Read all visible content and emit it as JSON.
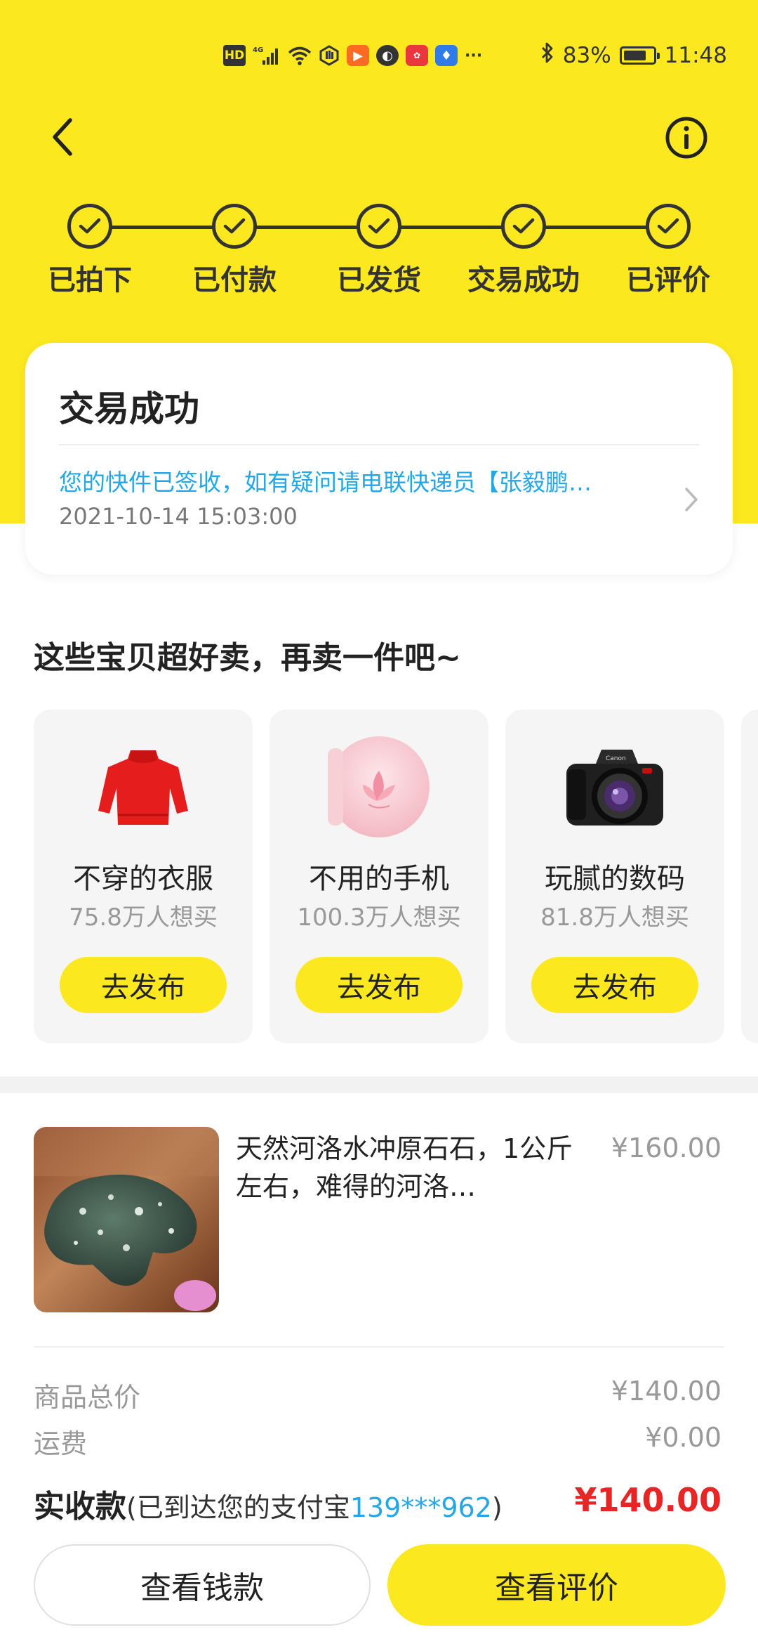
{
  "status_bar": {
    "time": "11:48",
    "battery": "83%",
    "battery_level": 0.83,
    "network": "4G",
    "hd_badge": "HD",
    "icons": [
      "hd-icon",
      "signal-icon",
      "wifi-icon",
      "hand-icon",
      "video-app-icon",
      "ball-app-icon",
      "huawei-app-icon",
      "bulb-app-icon",
      "more-icon",
      "bluetooth-icon",
      "battery-icon"
    ],
    "more": "···"
  },
  "nav": {
    "back_icon": "chevron-left-icon",
    "info_icon": "info-icon"
  },
  "steps": [
    {
      "label": "已拍下",
      "done": true
    },
    {
      "label": "已付款",
      "done": true
    },
    {
      "label": "已发货",
      "done": true
    },
    {
      "label": "交易成功",
      "done": true
    },
    {
      "label": "已评价",
      "done": true
    }
  ],
  "status_card": {
    "title": "交易成功",
    "message": "您的快件已签收，如有疑问请电联快递员【张毅鹏…",
    "time": "2021-10-14 15:03:00"
  },
  "recommend": {
    "title": "这些宝贝超好卖，再卖一件吧~",
    "cards": [
      {
        "name": "不穿的衣服",
        "count": "75.8万人想买",
        "button": "去发布",
        "icon": "sweater-icon"
      },
      {
        "name": "不用的手机",
        "count": "100.3万人想买",
        "button": "去发布",
        "icon": "phone-icon"
      },
      {
        "name": "玩腻的数码",
        "count": "81.8万人想买",
        "button": "去发布",
        "icon": "camera-icon"
      }
    ]
  },
  "order": {
    "title": "天然河洛水冲原石石，1公斤左右，难得的河洛…",
    "price": "¥160.00",
    "total_label": "商品总价",
    "total_value": "¥140.00",
    "shipping_label": "运费",
    "shipping_value": "¥0.00",
    "received_label": "实收款",
    "received_note_prefix": "(已到达您的支付宝",
    "received_account": "139***962",
    "received_note_suffix": ")",
    "received_value": "¥140.00"
  },
  "actions": {
    "view_money": "查看钱款",
    "view_review": "查看评价"
  },
  "colors": {
    "brand_yellow": "#FCE81F",
    "link_blue": "#23A7E6",
    "price_red": "#E82424"
  }
}
